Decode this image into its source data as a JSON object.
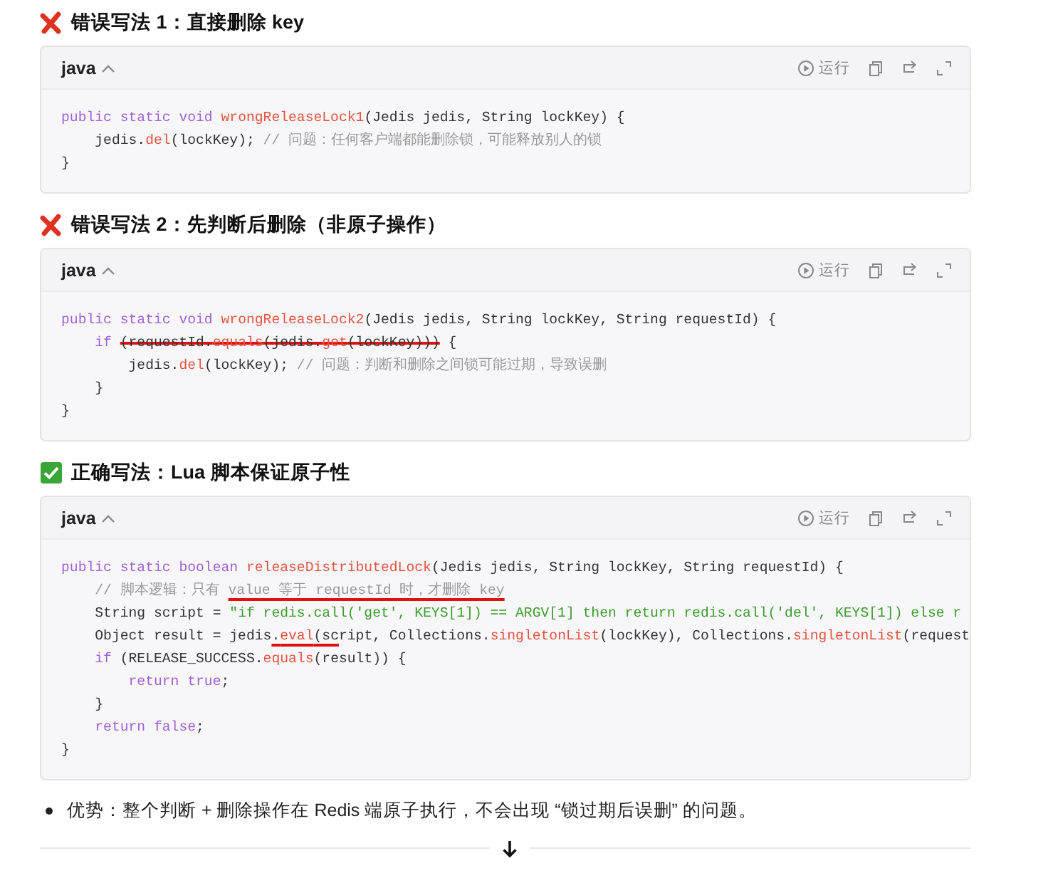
{
  "sections": [
    {
      "kind": "wrong",
      "heading": "错误写法 1：直接删除 key",
      "code": {
        "language": "java",
        "run_label": "运行",
        "lines": [
          [
            {
              "text": "public static void ",
              "kind": "keyword"
            },
            {
              "text": "wrongReleaseLock1",
              "kind": "method"
            },
            {
              "text": "(Jedis jedis, String lockKey) {",
              "kind": "plain"
            }
          ],
          [
            {
              "text": "    jedis.",
              "kind": "plain"
            },
            {
              "text": "del",
              "kind": "method"
            },
            {
              "text": "(lockKey); ",
              "kind": "plain"
            },
            {
              "text": "// 问题：任何客户端都能删除锁，可能释放别人的锁",
              "kind": "comment"
            }
          ],
          [
            {
              "text": "}",
              "kind": "plain"
            }
          ]
        ]
      }
    },
    {
      "kind": "wrong",
      "heading": "错误写法 2：先判断后删除（非原子操作）",
      "code": {
        "language": "java",
        "run_label": "运行",
        "lines": [
          [
            {
              "text": "public static void ",
              "kind": "keyword"
            },
            {
              "text": "wrongReleaseLock2",
              "kind": "method"
            },
            {
              "text": "(Jedis jedis, String lockKey, String requestId) {",
              "kind": "plain"
            }
          ],
          [
            {
              "text": "    if ",
              "kind": "keyword"
            },
            {
              "kind": "strike",
              "tokens": [
                {
                  "text": "(requestId.",
                  "kind": "plain"
                },
                {
                  "text": "equals",
                  "kind": "method"
                },
                {
                  "text": "(jedis.",
                  "kind": "plain"
                },
                {
                  "text": "get",
                  "kind": "method"
                },
                {
                  "text": "(lockKey)))",
                  "kind": "plain"
                }
              ]
            },
            {
              "text": " {",
              "kind": "plain"
            }
          ],
          [
            {
              "text": "        jedis.",
              "kind": "plain"
            },
            {
              "text": "del",
              "kind": "method"
            },
            {
              "text": "(lockKey); ",
              "kind": "plain"
            },
            {
              "text": "// 问题：判断和删除之间锁可能过期，导致误删",
              "kind": "comment"
            }
          ],
          [
            {
              "text": "    }",
              "kind": "plain"
            }
          ],
          [
            {
              "text": "}",
              "kind": "plain"
            }
          ]
        ]
      }
    },
    {
      "kind": "right",
      "heading": "正确写法：Lua 脚本保证原子性",
      "code": {
        "language": "java",
        "run_label": "运行",
        "lines": [
          [
            {
              "text": "public static boolean ",
              "kind": "keyword"
            },
            {
              "text": "releaseDistributedLock",
              "kind": "method"
            },
            {
              "text": "(Jedis jedis, String lockKey, String requestId) {",
              "kind": "plain"
            }
          ],
          [
            {
              "text": "    // 脚本逻辑：只有 ",
              "kind": "comment"
            },
            {
              "kind": "underline",
              "tokens": [
                {
                  "text": "value 等于 requestId 时，才删除 key",
                  "kind": "comment"
                }
              ]
            }
          ],
          [
            {
              "text": "    String script = ",
              "kind": "plain"
            },
            {
              "text": "\"if redis.call('get', KEYS[1]) == ARGV[1] then return redis.call('del', KEYS[1]) else r",
              "kind": "string"
            }
          ],
          [
            {
              "text": "    Object result = jedis",
              "kind": "plain"
            },
            {
              "kind": "underline",
              "tokens": [
                {
                  "text": ".",
                  "kind": "plain"
                },
                {
                  "text": "eval",
                  "kind": "method"
                },
                {
                  "text": "(sc",
                  "kind": "plain"
                }
              ]
            },
            {
              "text": "ript, Collections.",
              "kind": "plain"
            },
            {
              "text": "singletonList",
              "kind": "method"
            },
            {
              "text": "(lockKey), Collections.",
              "kind": "plain"
            },
            {
              "text": "singletonList",
              "kind": "method"
            },
            {
              "text": "(request",
              "kind": "plain"
            }
          ],
          [
            {
              "text": "    if ",
              "kind": "keyword"
            },
            {
              "text": "(RELEASE_SUCCESS.",
              "kind": "plain"
            },
            {
              "text": "equals",
              "kind": "method"
            },
            {
              "text": "(result)) {",
              "kind": "plain"
            }
          ],
          [
            {
              "text": "        return true",
              "kind": "keyword"
            },
            {
              "text": ";",
              "kind": "plain"
            }
          ],
          [
            {
              "text": "    }",
              "kind": "plain"
            }
          ],
          [
            {
              "text": "    return false",
              "kind": "keyword"
            },
            {
              "text": ";",
              "kind": "plain"
            }
          ],
          [
            {
              "text": "}",
              "kind": "plain"
            }
          ]
        ]
      }
    }
  ],
  "bullets": [
    "优势：整个判断 + 删除操作在 Redis 端原子执行，不会出现 “锁过期后误删” 的问题。"
  ]
}
